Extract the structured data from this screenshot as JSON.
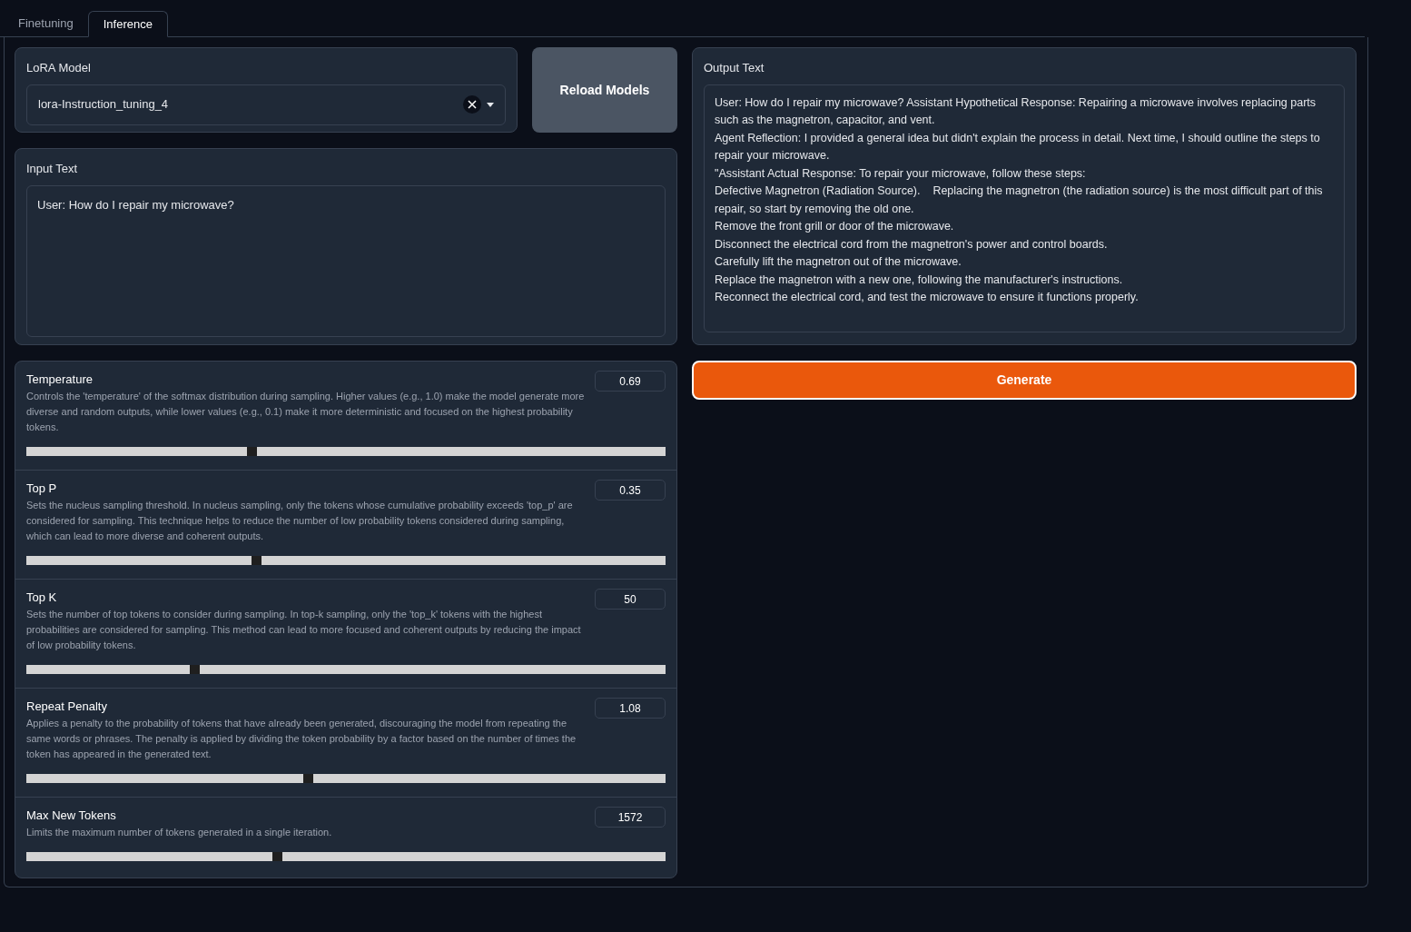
{
  "tabs": [
    {
      "label": "Finetuning",
      "selected": false
    },
    {
      "label": "Inference",
      "selected": true
    }
  ],
  "lora_model": {
    "label": "LoRA Model",
    "value": "lora-Instruction_tuning_4"
  },
  "reload_button": "Reload Models",
  "input_text": {
    "label": "Input Text",
    "value": "User: How do I repair my microwave?"
  },
  "output_text": {
    "label": "Output Text",
    "lines": [
      "User: How do I repair my microwave? Assistant Hypothetical Response: Repairing a microwave involves replacing parts such as the magnetron, capacitor, and vent.",
      "Agent Reflection: I provided a general idea but didn't explain the process in detail. Next time, I should outline the steps to repair your microwave.",
      "\"Assistant Actual Response: To repair your microwave, follow these steps:",
      "Defective Magnetron (Radiation Source).    Replacing the magnetron (the radiation source) is the most difficult part of this repair, so start by removing the old one.",
      "Remove the front grill or door of the microwave.",
      "Disconnect the electrical cord from the magnetron's power and control boards.",
      "Carefully lift the magnetron out of the microwave.",
      "Replace the magnetron with a new one, following the manufacturer's instructions.",
      "Reconnect the electrical cord, and test the microwave to ensure it functions properly."
    ]
  },
  "generate_button": "Generate",
  "sliders": [
    {
      "label": "Temperature",
      "description": "Controls the 'temperature' of the softmax distribution during sampling. Higher values (e.g., 1.0) make the model generate more diverse and random outputs, while lower values (e.g., 0.1) make it more deterministic and focused on the highest probability tokens.",
      "value": "0.69",
      "level": 0.345
    },
    {
      "label": "Top P",
      "description": "Sets the nucleus sampling threshold. In nucleus sampling, only the tokens whose cumulative probability exceeds 'top_p' are considered for sampling. This technique helps to reduce the number of low probability tokens considered during sampling, which can lead to more diverse and coherent outputs.",
      "value": "0.35",
      "level": 0.352
    },
    {
      "label": "Top K",
      "description": "Sets the number of top tokens to consider during sampling. In top-k sampling, only the 'top_k' tokens with the highest probabilities are considered for sampling. This method can lead to more focused and coherent outputs by reducing the impact of low probability tokens.",
      "value": "50",
      "level": 0.255
    },
    {
      "label": "Repeat Penalty",
      "description": "Applies a penalty to the probability of tokens that have already been generated, discouraging the model from repeating the same words or phrases. The penalty is applied by dividing the token probability by a factor based on the number of times the token has appeared in the generated text.",
      "value": "1.08",
      "level": 0.433
    },
    {
      "label": "Max New Tokens",
      "description": "Limits the maximum number of tokens generated in a single iteration.",
      "value": "1572",
      "level": 0.385
    }
  ]
}
